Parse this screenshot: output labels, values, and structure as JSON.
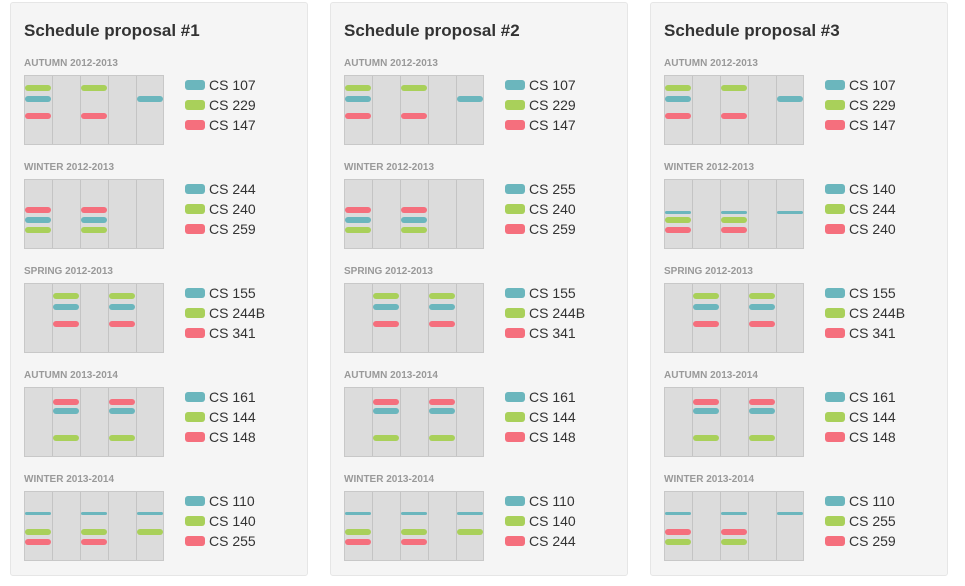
{
  "colors": {
    "teal": "#6bb6bd",
    "green": "#a9d05a",
    "red": "#f56f7d"
  },
  "proposals": [
    {
      "title": "Schedule proposal #1",
      "terms": [
        {
          "label": "AUTUMN 2012-2013",
          "courses": [
            "CS 107",
            "CS 229",
            "CS 147"
          ],
          "blocks": [
            {
              "c": 1,
              "d": [
                0,
                2
              ],
              "row": "r1"
            },
            {
              "c": 0,
              "d": [
                0,
                4
              ],
              "row": "r2"
            },
            {
              "c": 2,
              "d": [
                0,
                2
              ],
              "row": "r3"
            }
          ]
        },
        {
          "label": "WINTER 2012-2013",
          "courses": [
            "CS 244",
            "CS 240",
            "CS 259"
          ],
          "blocks": [
            {
              "c": 2,
              "d": [
                0,
                2
              ],
              "row": "r4"
            },
            {
              "c": 0,
              "d": [
                0,
                2
              ],
              "row": "r5"
            },
            {
              "c": 1,
              "d": [
                0,
                2
              ],
              "row": "r6"
            }
          ]
        },
        {
          "label": "SPRING 2012-2013",
          "courses": [
            "CS 155",
            "CS 244B",
            "CS 341"
          ],
          "blocks": [
            {
              "c": 1,
              "d": [
                1,
                3
              ],
              "row": "r1"
            },
            {
              "c": 0,
              "d": [
                1,
                3
              ],
              "row": "r2"
            },
            {
              "c": 2,
              "d": [
                1,
                3
              ],
              "row": "r3"
            }
          ]
        },
        {
          "label": "AUTUMN 2013-2014",
          "courses": [
            "CS 161",
            "CS 144",
            "CS 148"
          ],
          "blocks": [
            {
              "c": 2,
              "d": [
                1,
                3
              ],
              "row": "r0"
            },
            {
              "c": 0,
              "d": [
                1,
                3
              ],
              "row": "r0b"
            },
            {
              "c": 1,
              "d": [
                1,
                3
              ],
              "row": "r6"
            }
          ]
        },
        {
          "label": "WINTER 2013-2014",
          "courses": [
            "CS 110",
            "CS 140",
            "CS 255"
          ],
          "blocks": [
            {
              "c": 0,
              "d": [
                0,
                2,
                4
              ],
              "row": "t1"
            },
            {
              "c": 1,
              "d": [
                0,
                2,
                4
              ],
              "row": "r5"
            },
            {
              "c": 2,
              "d": [
                0,
                2
              ],
              "row": "r6"
            }
          ]
        }
      ]
    },
    {
      "title": "Schedule proposal #2",
      "terms": [
        {
          "label": "AUTUMN 2012-2013",
          "courses": [
            "CS 107",
            "CS 229",
            "CS 147"
          ],
          "blocks": [
            {
              "c": 1,
              "d": [
                0,
                2
              ],
              "row": "r1"
            },
            {
              "c": 0,
              "d": [
                0,
                4
              ],
              "row": "r2"
            },
            {
              "c": 2,
              "d": [
                0,
                2
              ],
              "row": "r3"
            }
          ]
        },
        {
          "label": "WINTER 2012-2013",
          "courses": [
            "CS 255",
            "CS 240",
            "CS 259"
          ],
          "blocks": [
            {
              "c": 2,
              "d": [
                0,
                2
              ],
              "row": "r4"
            },
            {
              "c": 0,
              "d": [
                0,
                2
              ],
              "row": "r5"
            },
            {
              "c": 1,
              "d": [
                0,
                2
              ],
              "row": "r6"
            }
          ]
        },
        {
          "label": "SPRING 2012-2013",
          "courses": [
            "CS 155",
            "CS 244B",
            "CS 341"
          ],
          "blocks": [
            {
              "c": 1,
              "d": [
                1,
                3
              ],
              "row": "r1"
            },
            {
              "c": 0,
              "d": [
                1,
                3
              ],
              "row": "r2"
            },
            {
              "c": 2,
              "d": [
                1,
                3
              ],
              "row": "r3"
            }
          ]
        },
        {
          "label": "AUTUMN 2013-2014",
          "courses": [
            "CS 161",
            "CS 144",
            "CS 148"
          ],
          "blocks": [
            {
              "c": 2,
              "d": [
                1,
                3
              ],
              "row": "r0"
            },
            {
              "c": 0,
              "d": [
                1,
                3
              ],
              "row": "r0b"
            },
            {
              "c": 1,
              "d": [
                1,
                3
              ],
              "row": "r6"
            }
          ]
        },
        {
          "label": "WINTER 2013-2014",
          "courses": [
            "CS 110",
            "CS 140",
            "CS 244"
          ],
          "blocks": [
            {
              "c": 0,
              "d": [
                0,
                2,
                4
              ],
              "row": "t1"
            },
            {
              "c": 1,
              "d": [
                0,
                2,
                4
              ],
              "row": "r5"
            },
            {
              "c": 2,
              "d": [
                0,
                2
              ],
              "row": "r6"
            }
          ]
        }
      ]
    },
    {
      "title": "Schedule proposal #3",
      "terms": [
        {
          "label": "AUTUMN 2012-2013",
          "courses": [
            "CS 107",
            "CS 229",
            "CS 147"
          ],
          "blocks": [
            {
              "c": 1,
              "d": [
                0,
                2
              ],
              "row": "r1"
            },
            {
              "c": 0,
              "d": [
                0,
                4
              ],
              "row": "r2"
            },
            {
              "c": 2,
              "d": [
                0,
                2
              ],
              "row": "r3"
            }
          ]
        },
        {
          "label": "WINTER 2012-2013",
          "courses": [
            "CS 140",
            "CS 244",
            "CS 240"
          ],
          "blocks": [
            {
              "c": 0,
              "d": [
                0,
                2,
                4
              ],
              "row": "t2"
            },
            {
              "c": 1,
              "d": [
                0,
                2
              ],
              "row": "r5"
            },
            {
              "c": 2,
              "d": [
                0,
                2
              ],
              "row": "r6"
            }
          ]
        },
        {
          "label": "SPRING 2012-2013",
          "courses": [
            "CS 155",
            "CS 244B",
            "CS 341"
          ],
          "blocks": [
            {
              "c": 1,
              "d": [
                1,
                3
              ],
              "row": "r1"
            },
            {
              "c": 0,
              "d": [
                1,
                3
              ],
              "row": "r2"
            },
            {
              "c": 2,
              "d": [
                1,
                3
              ],
              "row": "r3"
            }
          ]
        },
        {
          "label": "AUTUMN 2013-2014",
          "courses": [
            "CS 161",
            "CS 144",
            "CS 148"
          ],
          "blocks": [
            {
              "c": 2,
              "d": [
                1,
                3
              ],
              "row": "r0"
            },
            {
              "c": 0,
              "d": [
                1,
                3
              ],
              "row": "r0b"
            },
            {
              "c": 1,
              "d": [
                1,
                3
              ],
              "row": "r6"
            }
          ]
        },
        {
          "label": "WINTER 2013-2014",
          "courses": [
            "CS 110",
            "CS 255",
            "CS 259"
          ],
          "blocks": [
            {
              "c": 0,
              "d": [
                0,
                2,
                4
              ],
              "row": "t1"
            },
            {
              "c": 2,
              "d": [
                0,
                2
              ],
              "row": "r5"
            },
            {
              "c": 1,
              "d": [
                0,
                2
              ],
              "row": "r6"
            }
          ]
        }
      ]
    }
  ]
}
